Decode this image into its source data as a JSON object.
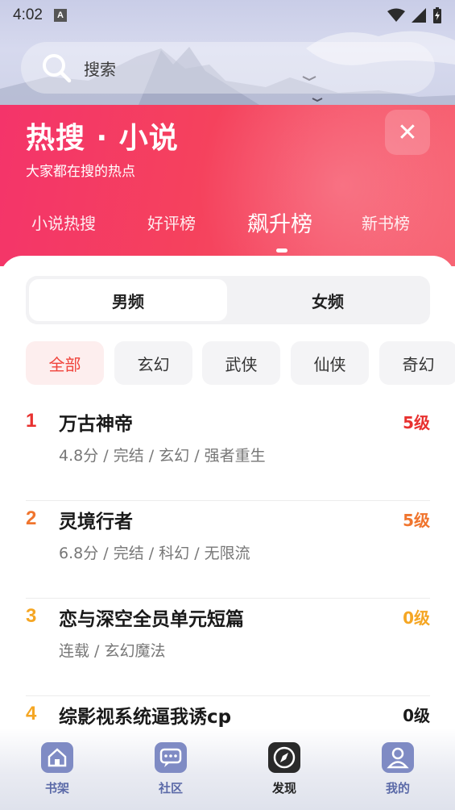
{
  "status_bar": {
    "time": "4:02",
    "a_badge": "A"
  },
  "search": {
    "placeholder": "搜索"
  },
  "hot_panel": {
    "title": "热搜 · 小说",
    "subtitle": "大家都在搜的热点",
    "tabs": [
      {
        "label": "小说热搜"
      },
      {
        "label": "好评榜"
      },
      {
        "label": "飙升榜"
      },
      {
        "label": "新书榜"
      }
    ],
    "active_tab": "飙升榜"
  },
  "gender": {
    "options": [
      "男频",
      "女频"
    ],
    "selected": "男频"
  },
  "categories": {
    "items": [
      "全部",
      "玄幻",
      "武侠",
      "仙侠",
      "奇幻"
    ],
    "selected": "全部"
  },
  "books": [
    {
      "rank": "1",
      "title": "万古神帝",
      "meta": "4.8分 / 完结 / 玄幻 / 强者重生",
      "level": "5级",
      "rank_color": "#e8312f",
      "level_color": "#e8312f"
    },
    {
      "rank": "2",
      "title": "灵境行者",
      "meta": "6.8分 / 完结 / 科幻 / 无限流",
      "level": "5级",
      "rank_color": "#f0752e",
      "level_color": "#f0752e"
    },
    {
      "rank": "3",
      "title": "恋与深空全员单元短篇",
      "meta": "连载 / 玄幻魔法",
      "level": "0级",
      "rank_color": "#f5a623",
      "level_color": "#f5a623"
    },
    {
      "rank": "4",
      "title": "综影视系统逼我诱cp",
      "meta": "",
      "level": "0级",
      "rank_color": "#f5a623",
      "level_color": "#1a1a1a"
    }
  ],
  "bottom_nav": {
    "items": [
      {
        "label": "书架",
        "icon": "bookshelf-home-icon"
      },
      {
        "label": "社区",
        "icon": "community-chat-icon"
      },
      {
        "label": "发现",
        "icon": "discover-compass-icon"
      },
      {
        "label": "我的",
        "icon": "profile-person-icon"
      }
    ],
    "active": "发现"
  },
  "colors": {
    "accent_red": "#f4346a",
    "chip_active_text": "#f0443c",
    "nav_inactive": "#5b6aa8",
    "nav_active": "#222222"
  }
}
